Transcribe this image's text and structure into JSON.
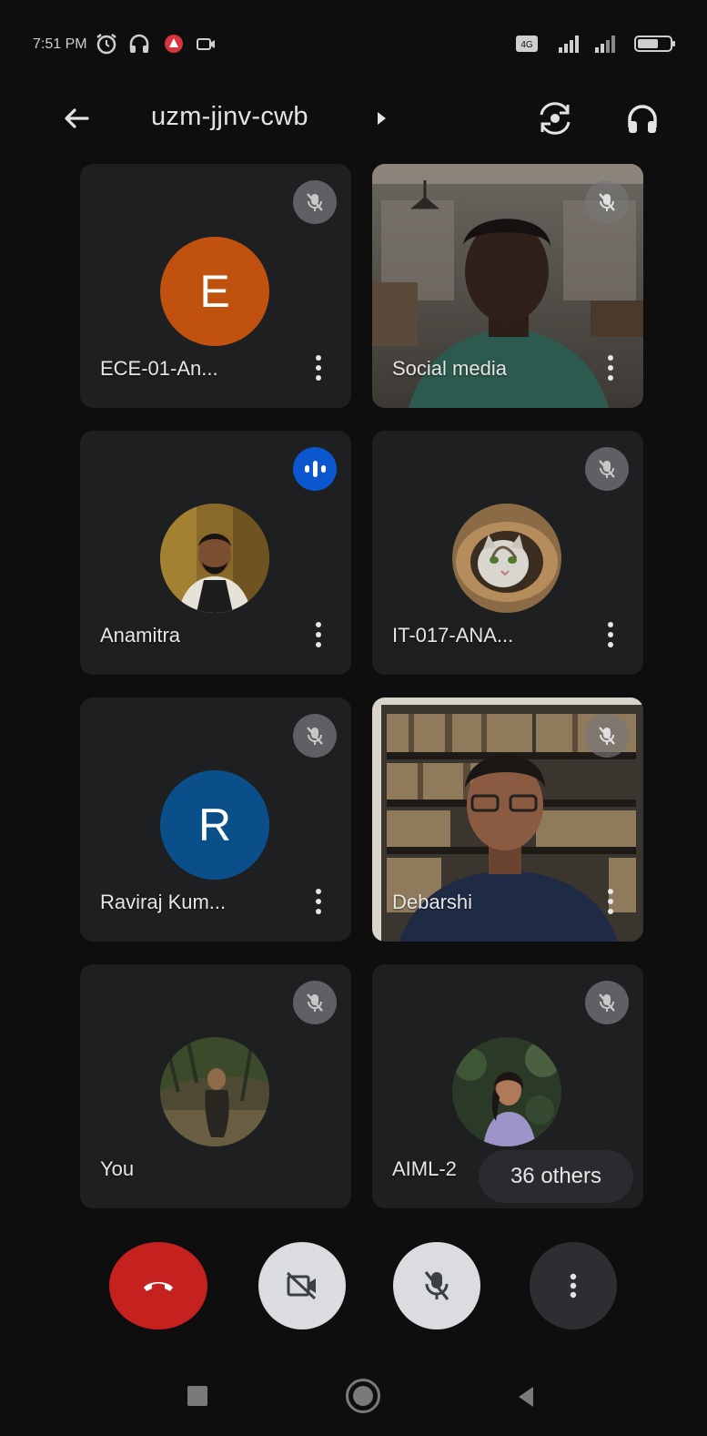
{
  "status_bar": {
    "time": "7:51 PM",
    "left_icons": [
      "alarm-icon",
      "headphones-icon",
      "app-notification-icon",
      "camera-notification-icon"
    ],
    "right_icons": [
      "volte-icon",
      "signal-icon",
      "signal-icon",
      "battery-icon"
    ]
  },
  "header": {
    "title": "uzm-jjnv-cwb",
    "back_icon": "arrow-left-icon",
    "switch_camera_icon": "switch-camera-icon",
    "audio_icon": "headphones-icon"
  },
  "tiles": [
    {
      "name": "ECE-01-An...",
      "avatar_type": "letter",
      "avatar_letter": "E",
      "avatar_color": "#c0510f",
      "status": "muted"
    },
    {
      "name": "Social media",
      "avatar_type": "video",
      "status": "muted"
    },
    {
      "name": "Anamitra",
      "avatar_type": "photo",
      "status": "speaking"
    },
    {
      "name": "IT-017-ANA...",
      "avatar_type": "photo",
      "status": "muted"
    },
    {
      "name": "Raviraj Kum...",
      "avatar_type": "letter",
      "avatar_letter": "R",
      "avatar_color": "#0b4f8a",
      "status": "muted"
    },
    {
      "name": "Debarshi",
      "avatar_type": "video",
      "status": "muted"
    },
    {
      "name": "You",
      "avatar_type": "photo",
      "status": "muted"
    },
    {
      "name": "AIML-2",
      "avatar_type": "photo",
      "status": "muted"
    }
  ],
  "others_chip": "36 others",
  "controls": {
    "end_call_icon": "end-call-icon",
    "camera_icon": "camera-off-icon",
    "mic_icon": "mic-off-icon",
    "more_icon": "more-vertical-icon"
  },
  "colors": {
    "background": "#0e0e0e",
    "tile": "#1e1f21",
    "end_call": "#c5221f",
    "speaking": "#0b57d0"
  }
}
